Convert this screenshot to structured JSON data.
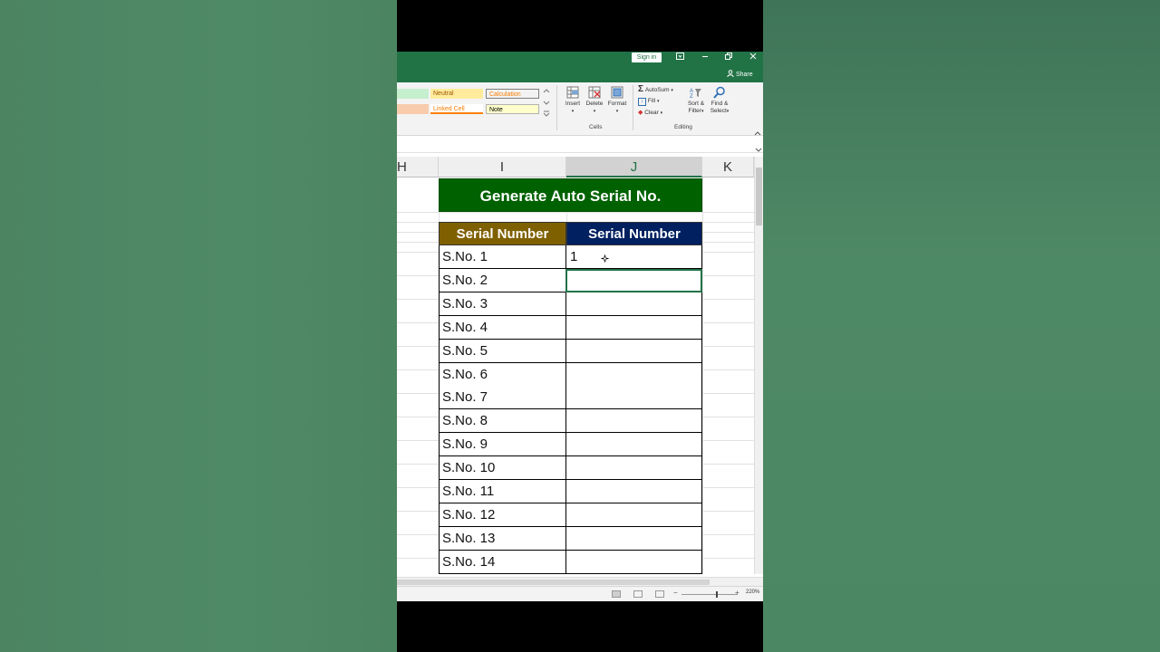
{
  "window": {
    "sign_in": "Sign in",
    "share": "Share",
    "icons": [
      "ribbon-display-icon",
      "minimize-icon",
      "restore-icon",
      "close-icon"
    ]
  },
  "ribbon": {
    "styles": [
      {
        "label": "",
        "bg": "#c6efce",
        "fg": "#006100"
      },
      {
        "label": "Neutral",
        "bg": "#ffeb9c",
        "fg": "#9c5700"
      },
      {
        "label": "Calculation",
        "bg": "#f2f2f2",
        "fg": "#fa7d00"
      },
      {
        "label": "",
        "bg": "#f8cbad",
        "fg": "#000000"
      },
      {
        "label": "Linked Cell",
        "bg": "#ffffff",
        "fg": "#fa7d00"
      },
      {
        "label": "Note",
        "bg": "#ffffcc",
        "fg": "#000000"
      }
    ],
    "cells_group": {
      "label": "Cells",
      "insert": "Insert",
      "delete": "Delete",
      "format": "Format"
    },
    "editing_group": {
      "label": "Editing",
      "autosum": "AutoSum",
      "fill": "Fill",
      "clear": "Clear",
      "sort_filter_1": "Sort &",
      "sort_filter_2": "Filter",
      "find_select_1": "Find &",
      "find_select_2": "Select"
    }
  },
  "columns": [
    "H",
    "I",
    "J",
    "K"
  ],
  "selected_column": "J",
  "sheet": {
    "banner": "Generate Auto Serial No.",
    "header_i": "Serial Number",
    "header_j": "Serial Number",
    "rows": [
      {
        "i": "S.No. 1",
        "j": "1"
      },
      {
        "i": "S.No. 2",
        "j": ""
      },
      {
        "i": "S.No. 3",
        "j": ""
      },
      {
        "i": "S.No. 4",
        "j": ""
      },
      {
        "i": "S.No. 5",
        "j": ""
      },
      {
        "i": "S.No. 6",
        "j": ""
      },
      {
        "i": "S.No. 7",
        "j": ""
      },
      {
        "i": "S.No. 8",
        "j": ""
      },
      {
        "i": "S.No. 9",
        "j": ""
      },
      {
        "i": "S.No. 10",
        "j": ""
      },
      {
        "i": "S.No. 11",
        "j": ""
      },
      {
        "i": "S.No. 12",
        "j": ""
      },
      {
        "i": "S.No. 13",
        "j": ""
      },
      {
        "i": "S.No. 14",
        "j": ""
      }
    ]
  },
  "status": {
    "zoom": "220%"
  },
  "colors": {
    "excel_green": "#217346",
    "banner_bg": "#006100",
    "header_i_bg": "#7f6000",
    "header_j_bg": "#002060"
  }
}
